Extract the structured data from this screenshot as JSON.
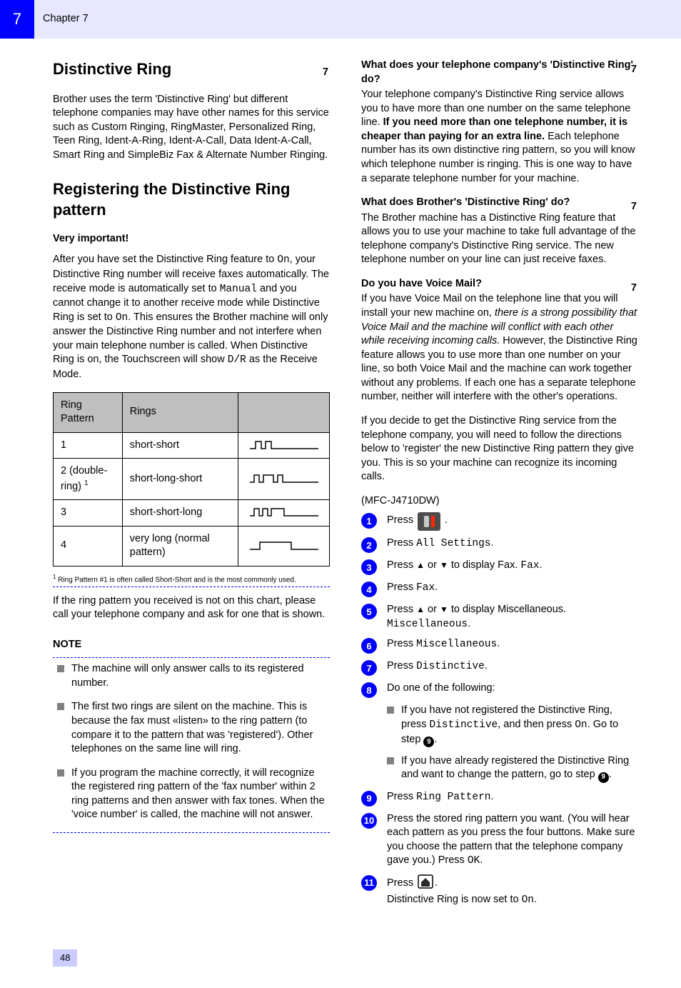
{
  "header": {
    "chapter_number": "7",
    "chapter_label": "Chapter 7"
  },
  "page_number": "48",
  "left": {
    "title": "Distinctive Ring",
    "para1": "Brother uses the term 'Distinctive Ring' but different telephone companies may have other names for this service such as Custom Ringing, RingMaster, Personalized Ring, Teen Ring, Ident-A-Ring, Ident-A-Call, Data Ident-A-Call, Smart Ring and SimpleBiz Fax & Alternate Number Ringing.",
    "subhead1": "What does your telephone company's 'Distinctive Ring' do?",
    "para2": "Your telephone company's Distinctive Ring service allows you to have more than one number on the same telephone line. If you need more than one telephone number, it is cheaper than paying for an extra line. Each telephone number has its own distinctive ring pattern, so you will know which telephone number is ringing. This is one way to have a separate telephone number for your machine.",
    "subhead2": "What does Brother's 'Distinctive Ring' do?",
    "para3_a": "The Brother machine has a Distinctive Ring feature that allows you to use your machine to take full advantage of the telephone company's Distinctive Ring service. The new telephone number on your line can just receive faxes.",
    "ref7": "7",
    "subhead3": "Do you have Voice Mail?",
    "para4_a": "If you have Voice Mail on the telephone line that you will install your new machine on, ",
    "para4_i": "there is a strong possibility that Voice Mail and the machine will conflict with each other while receiving incoming calls.",
    "para4_b": " However, the Distinctive Ring feature allows you to use more than one number on your line, so both Voice Mail and the machine can work together without any problems. If each one has a separate telephone number, neither will interfere with the other's operations.",
    "para5": "If you decide to get the Distinctive Ring service from the telephone company, you will need to follow the directions below to 'register' the new Distinctive Ring pattern they give you. This is so your machine can recognize its incoming calls."
  },
  "right": {
    "title": "Registering the Distinctive Ring pattern",
    "sub": "Very important!",
    "para1": "After you have set the Distinctive Ring feature to On, your Distinctive Ring number will receive faxes automatically. The receive mode is automatically set to Manual and you cannot change it to another receive mode while Distinctive Ring is set to On. This ensures the Brother machine will only answer the Distinctive Ring number and not interfere when your main telephone number is called. When Distinctive Ring is on, the Touchscreen will show D/R as the Receive Mode.",
    "table": {
      "headers": [
        "Ring Pattern",
        "Rings",
        ""
      ],
      "rows_visible": [
        {
          "c1": "1",
          "c2": "short-short",
          "svg": "p1"
        },
        {
          "c1": "2 (double-ring)",
          "c2": "short-long-short",
          "svg": "p2"
        },
        {
          "c1": "3",
          "c2": "short-short-long",
          "svg": "p3"
        },
        {
          "c1": "4",
          "c2": "very long (normal pattern)",
          "svg": "p4"
        }
      ]
    },
    "footnote1_label": "1",
    "footnote1": "Ring Pattern #1 is often called Short-Short and is the most commonly used.",
    "footnote2": "If the ring pattern you received is not on this chart, please call your telephone company and ask for one that is shown.",
    "note_heading": "NOTE",
    "notes": [
      "The machine will only answer calls to its registered number.",
      "The first two rings are silent on the machine. This is because the fax must «listen» to the ring pattern (to compare it to the pattern that was 'registered'). Other telephones on the same line will ring.",
      "If you program the machine correctly, it will recognize the registered ring pattern of the 'fax number' within 2 ring patterns and then answer with fax tones. When the 'voice number' is called, the machine will not answer."
    ],
    "model": "(MFC-J4710DW)",
    "steps": {
      "1": "Press ",
      "1b": ".",
      "2": "Press All Settings.",
      "3a": "Press ",
      "3b": " or ",
      "3c": " to display Fax.",
      "4": "Press Fax.",
      "5a": "Press ",
      "5b": " or ",
      "5c": " to display Miscellaneous.",
      "6": "Press Miscellaneous.",
      "7": "Press Distinctive.",
      "8": "Do one of the following:",
      "8a": "If you have not registered the Distinctive Ring, press Distinctive, and then press On. Go to step ",
      "8b": "If you have already registered the Distinctive Ring and want to change the pattern, go to step ",
      "9": "Press Ring Pattern.",
      "10": "Press the stored ring pattern you want. (You will hear each pattern as you press the four buttons. Make sure you choose the pattern that the telephone company gave you.) Press OK.",
      "11": "Press ",
      "11b": ".",
      "11c": " Distinctive Ring is now set to On."
    },
    "step_ref_9": "9"
  }
}
